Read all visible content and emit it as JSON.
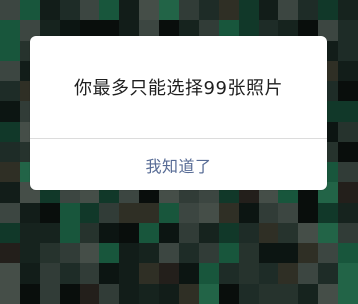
{
  "dialog": {
    "message": "你最多只能选择99张照片",
    "confirm_label": "我知道了"
  },
  "colors": {
    "background_dark": "#0e1613",
    "mosaic_green": "#1e6a4a",
    "mosaic_grey": "#3c4a44",
    "dialog_bg": "#ffffff",
    "message_text": "#1f1f1f",
    "button_text": "#576b95",
    "divider": "#dcdcdc"
  }
}
